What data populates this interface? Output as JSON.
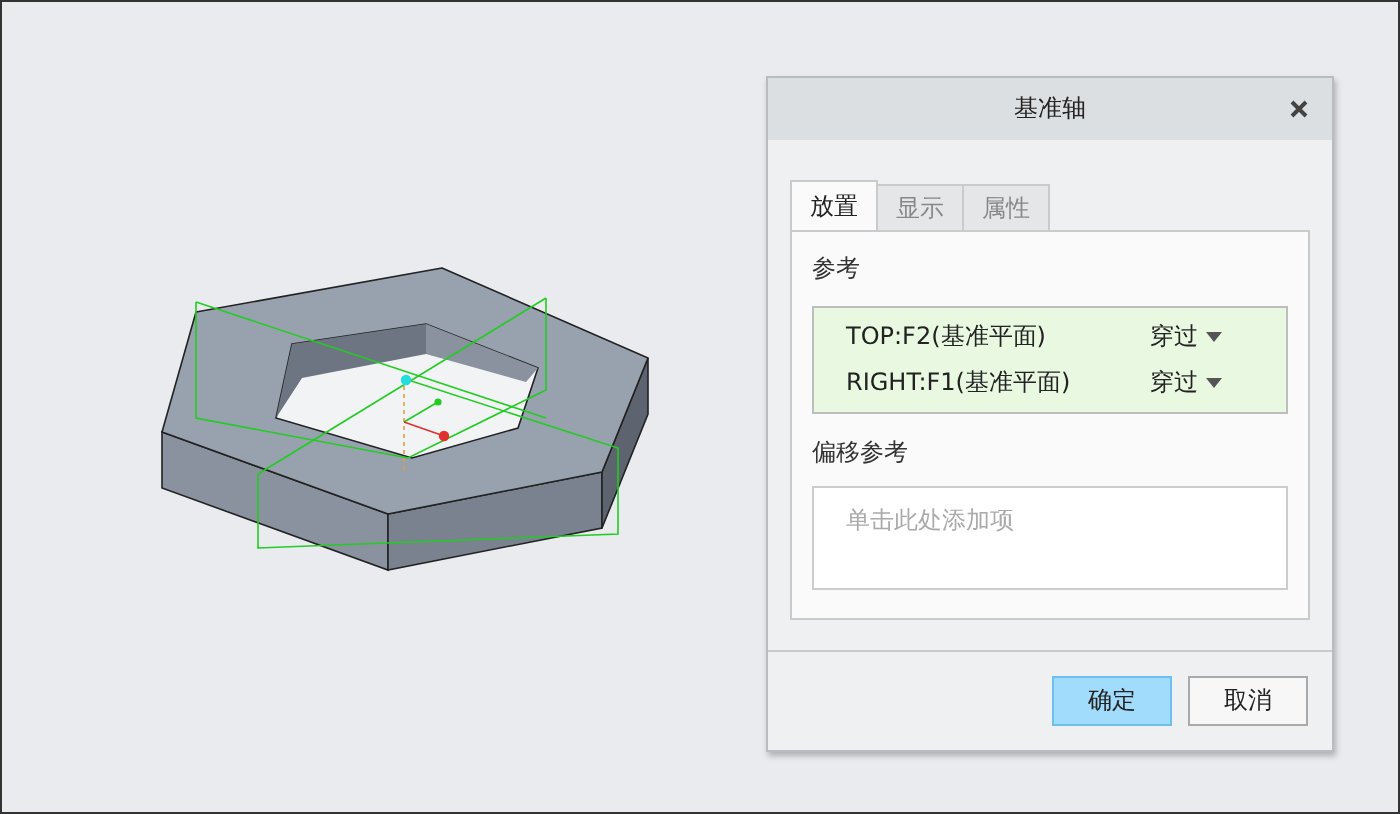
{
  "dialog": {
    "title": "基准轴",
    "tabs": [
      {
        "label": "放置",
        "selected": true
      },
      {
        "label": "显示",
        "selected": false
      },
      {
        "label": "属性",
        "selected": false
      }
    ],
    "references": {
      "label": "参考",
      "rows": [
        {
          "name": "TOP:F2(基准平面)",
          "constraint": "穿过"
        },
        {
          "name": "RIGHT:F1(基准平面)",
          "constraint": "穿过"
        }
      ]
    },
    "offset_references": {
      "label": "偏移参考",
      "placeholder": "单击此处添加项"
    },
    "buttons": [
      {
        "label": "确定",
        "kind": "primary"
      },
      {
        "label": "取消",
        "kind": "default"
      }
    ]
  }
}
